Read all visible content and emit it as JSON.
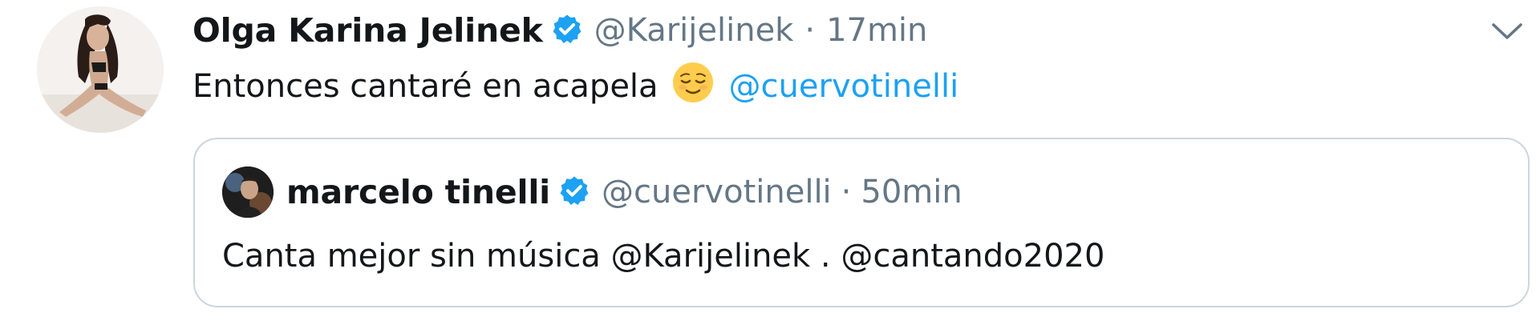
{
  "tweet": {
    "author_name": "Olga Karina Jelinek",
    "handle": "@Karijelinek",
    "separator": "·",
    "time": "17min",
    "text": "Entonces cantaré en acapela",
    "emoji": "relieved-face-emoji",
    "mention": "@cuervotinelli",
    "menu_icon": "chevron-down-icon"
  },
  "quoted_tweet": {
    "author_name": "marcelo tinelli",
    "handle": "@cuervotinelli",
    "separator": "·",
    "time": "50min",
    "text": "Canta mejor sin música @Karijelinek . @cantando2020"
  },
  "colors": {
    "link": "#1da1f2",
    "verified_badge": "#1da1f2",
    "muted_text": "#657786",
    "border": "#ccd6dd"
  }
}
